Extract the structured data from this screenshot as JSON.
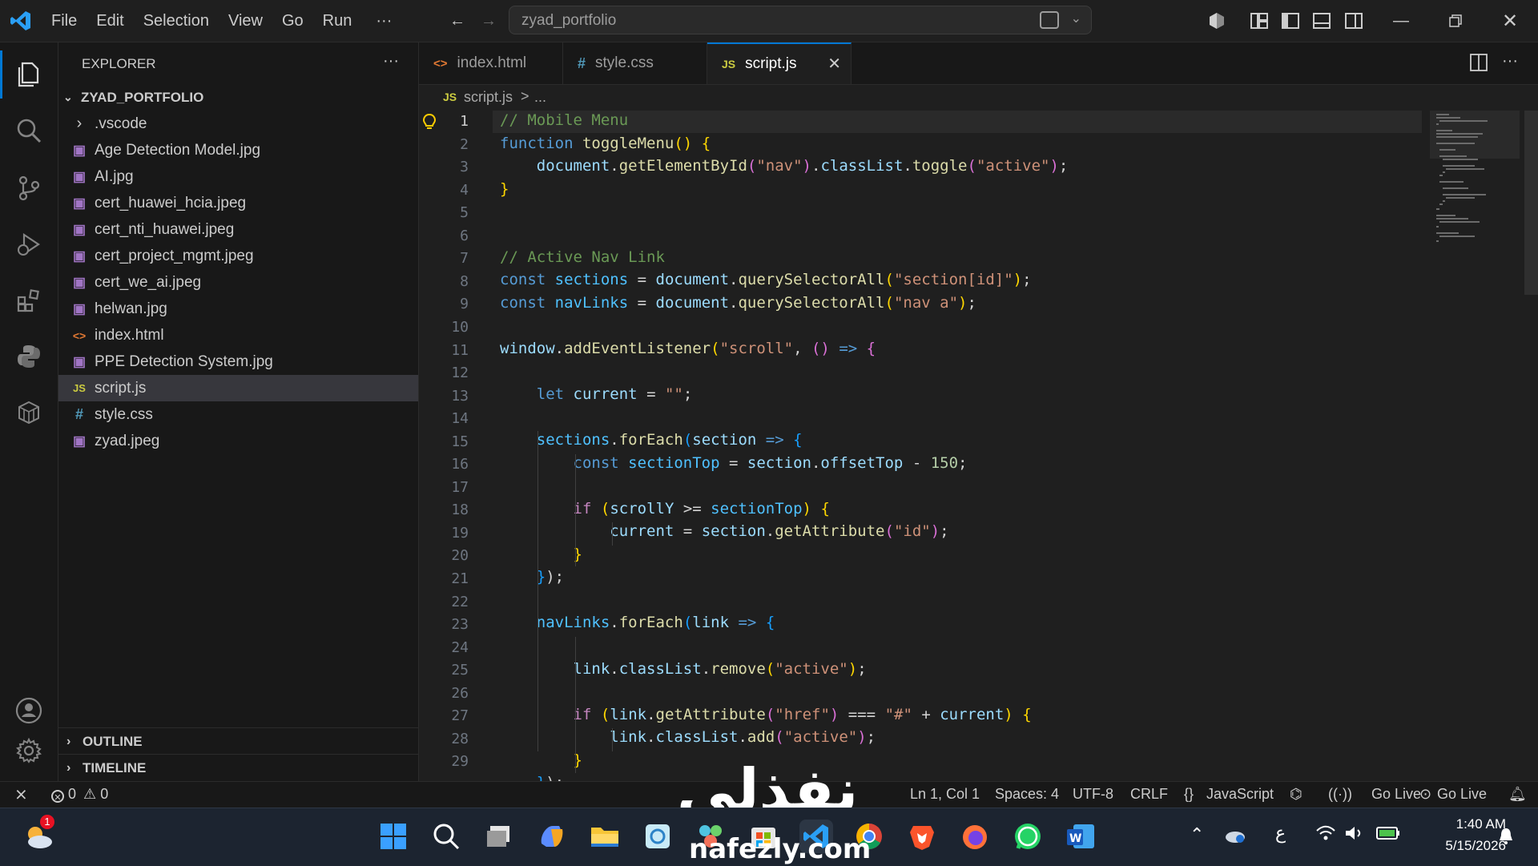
{
  "menu": [
    "File",
    "Edit",
    "Selection",
    "View",
    "Go",
    "Run",
    "···"
  ],
  "command_center": {
    "text": "zyad_portfolio"
  },
  "explorer": {
    "title": "EXPLORER",
    "more": "···",
    "root": "ZYAD_PORTFOLIO",
    "items": [
      {
        "label": ".vscode",
        "type": "folder"
      },
      {
        "label": "Age Detection Model.jpg",
        "type": "image"
      },
      {
        "label": "AI.jpg",
        "type": "image"
      },
      {
        "label": "cert_huawei_hcia.jpeg",
        "type": "image"
      },
      {
        "label": "cert_nti_huawei.jpeg",
        "type": "image"
      },
      {
        "label": "cert_project_mgmt.jpeg",
        "type": "image"
      },
      {
        "label": "cert_we_ai.jpeg",
        "type": "image"
      },
      {
        "label": "helwan.jpg",
        "type": "image"
      },
      {
        "label": "index.html",
        "type": "html"
      },
      {
        "label": "PPE Detection System.jpg",
        "type": "image"
      },
      {
        "label": "script.js",
        "type": "js",
        "selected": true
      },
      {
        "label": "style.css",
        "type": "css"
      },
      {
        "label": "zyad.jpeg",
        "type": "image"
      }
    ],
    "outline": "OUTLINE",
    "timeline": "TIMELINE"
  },
  "tabs": [
    {
      "label": "index.html",
      "icon": "<>",
      "active": false
    },
    {
      "label": "style.css",
      "icon": "#",
      "active": false
    },
    {
      "label": "script.js",
      "icon": "JS",
      "active": true
    }
  ],
  "breadcrumb": {
    "icon": "JS",
    "file": "script.js",
    "sep": ">",
    "rest": "..."
  },
  "code_lines": [
    "1",
    "2",
    "3",
    "4",
    "5",
    "6",
    "7",
    "8",
    "9",
    "10",
    "11",
    "12",
    "13",
    "14",
    "15",
    "16",
    "17",
    "18",
    "19",
    "20",
    "21",
    "22",
    "23",
    "24",
    "25",
    "26",
    "27",
    "28",
    "29"
  ],
  "status": {
    "errors": "0",
    "warnings": "0",
    "position": "Ln 1, Col 1",
    "spaces": "Spaces: 4",
    "encoding": "UTF-8",
    "eol": "CRLF",
    "language": "JavaScript",
    "golive1": "Go Live",
    "golive2": "Go Live"
  },
  "taskbar": {
    "weather_badge": "1",
    "lang": "ع",
    "time": "1:40 AM",
    "date": "5/15/2026"
  },
  "watermark": {
    "arabic": "نفذلي",
    "latin": "nafezly.com"
  },
  "colors": {
    "accent": "#0078d4",
    "js": "#cbcb41",
    "css": "#519aba",
    "html": "#e37933",
    "image": "#a074c4"
  }
}
